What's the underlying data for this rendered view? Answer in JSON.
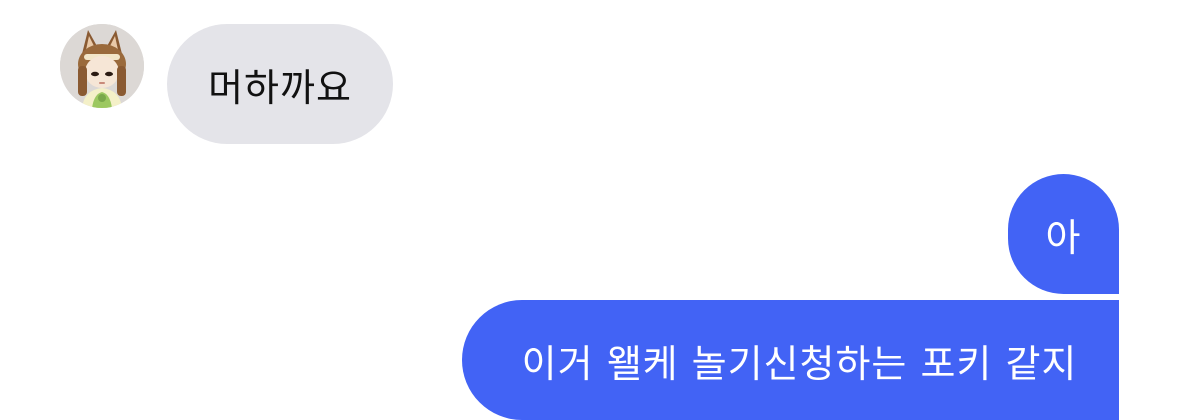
{
  "colors": {
    "incoming_bubble": "#e4e4e9",
    "outgoing_bubble": "#4263f5",
    "incoming_text": "#111111",
    "outgoing_text": "#ffffff"
  },
  "messages": [
    {
      "direction": "incoming",
      "text": "머하까요",
      "has_avatar": true
    },
    {
      "direction": "outgoing",
      "text": "아"
    },
    {
      "direction": "outgoing",
      "text": "이거 왤케 놀기신청하는 포키 같지"
    }
  ]
}
